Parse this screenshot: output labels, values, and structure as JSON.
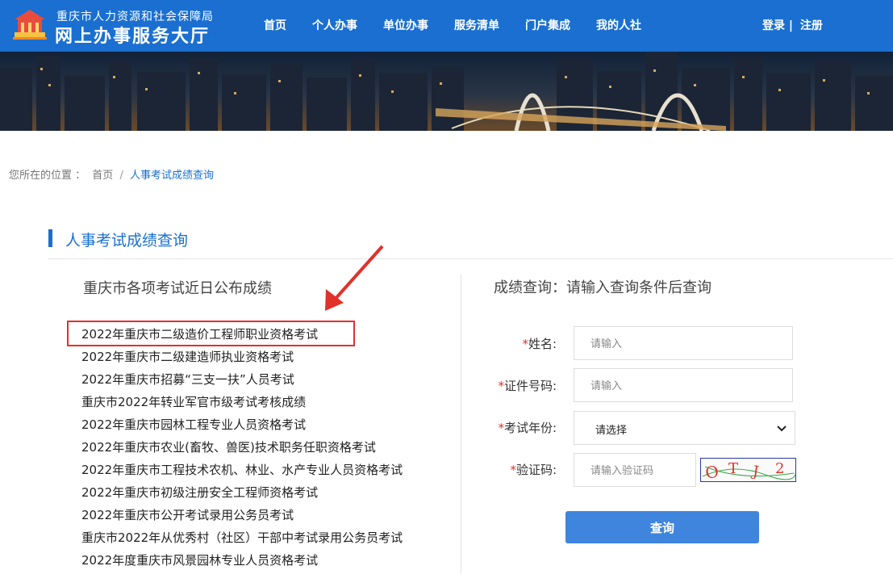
{
  "header": {
    "org_name": "重庆市人力资源和社会保障局",
    "site_title": "网上办事服务大厅",
    "nav": [
      "首页",
      "个人办事",
      "单位办事",
      "服务清单",
      "门户集成",
      "我的人社"
    ],
    "login": "登录",
    "auth_separator": "|",
    "register": "注册",
    "logo_icon": "building-emblem-icon"
  },
  "banner": {
    "image": "city-bridge-night-skyline"
  },
  "breadcrumb": {
    "prefix": "您所在的位置 ：",
    "home": "首页",
    "separator": "/",
    "current": "人事考试成绩查询"
  },
  "section": {
    "title": "人事考试成绩查询"
  },
  "left": {
    "heading": "重庆市各项考试近日公布成绩",
    "exams": [
      "2022年重庆市二级造价工程师职业资格考试",
      "2022年重庆市二级建造师执业资格考试",
      "2022年重庆市招募“三支一扶”人员考试",
      "重庆市2022年转业军官市级考试考核成绩",
      "2022年重庆市园林工程专业人员资格考试",
      "2022年重庆市农业(畜牧、兽医)技术职务任职资格考试",
      "2022年重庆市工程技术农机、林业、水产专业人员资格考试",
      "2022年重庆市初级注册安全工程师资格考试",
      "2022年重庆市公开考试录用公务员考试",
      "重庆市2022年从优秀村（社区）干部中考试录用公务员考试",
      "2022年度重庆市风景园林专业人员资格考试"
    ],
    "highlight_color": "#e0312a"
  },
  "form": {
    "heading": "成绩查询：请输入查询条件后查询",
    "required_mark": "*",
    "name_label": "姓名:",
    "name_placeholder": "请输入",
    "id_label": "证件号码:",
    "id_placeholder": "请输入",
    "year_label": "考试年份:",
    "year_selected": "请选择",
    "captcha_label": "验证码:",
    "captcha_placeholder": "请输入验证码",
    "captcha_chars": [
      "O",
      "T",
      "J",
      "2"
    ],
    "submit": "查询"
  },
  "colors": {
    "primary": "#1a6fd1",
    "button": "#3f85dd",
    "accent_red": "#e0312a"
  }
}
